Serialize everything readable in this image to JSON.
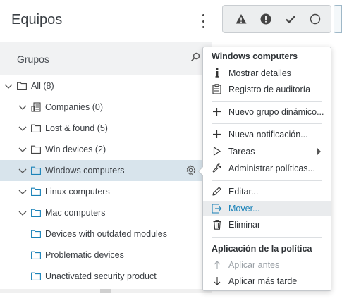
{
  "panel": {
    "title": "Equipos"
  },
  "groups": {
    "label": "Grupos"
  },
  "tree": [
    {
      "label": "All (8)",
      "level": 0,
      "expanded": true,
      "icon": "folder-icon"
    },
    {
      "label": "Companies (0)",
      "level": 1,
      "expanded": true,
      "icon": "companies-icon"
    },
    {
      "label": "Lost & found (5)",
      "level": 1,
      "expanded": true,
      "icon": "folder-icon"
    },
    {
      "label": "Win devices (2)",
      "level": 1,
      "expanded": true,
      "icon": "folder-icon"
    },
    {
      "label": "Windows computers",
      "level": 1,
      "expanded": true,
      "icon": "dynamic-folder-icon",
      "selected": true
    },
    {
      "label": "Linux computers",
      "level": 1,
      "expanded": true,
      "icon": "dynamic-folder-icon"
    },
    {
      "label": "Mac computers",
      "level": 1,
      "expanded": true,
      "icon": "dynamic-folder-icon"
    },
    {
      "label": "Devices with outdated modules",
      "level": 2,
      "icon": "dynamic-folder-icon"
    },
    {
      "label": "Problematic devices",
      "level": 2,
      "icon": "dynamic-folder-icon"
    },
    {
      "label": "Unactivated security product",
      "level": 2,
      "icon": "dynamic-folder-icon"
    }
  ],
  "context_menu": {
    "section1": "Windows computers",
    "items1": [
      {
        "label": "Mostrar detalles",
        "icon": "info-icon"
      },
      {
        "label": "Registro de auditoría",
        "icon": "audit-log-icon"
      }
    ],
    "items2": [
      {
        "label": "Nuevo grupo dinámico...",
        "icon": "plus-icon"
      }
    ],
    "items3": [
      {
        "label": "Nueva notificación...",
        "icon": "plus-icon"
      },
      {
        "label": "Tareas",
        "icon": "play-icon",
        "submenu": true
      },
      {
        "label": "Administrar políticas...",
        "icon": "wrench-icon"
      }
    ],
    "items4": [
      {
        "label": "Editar...",
        "icon": "pencil-icon"
      },
      {
        "label": "Mover...",
        "icon": "move-icon",
        "hover": true
      },
      {
        "label": "Eliminar",
        "icon": "trash-icon"
      }
    ],
    "section2": "Aplicación de la política",
    "items5": [
      {
        "label": "Aplicar antes",
        "icon": "arrow-up-icon",
        "disabled": true
      },
      {
        "label": "Aplicar más tarde",
        "icon": "arrow-down-icon"
      }
    ]
  },
  "colors": {
    "accent": "#1a82b8",
    "selected_row": "#d8e4ec",
    "warning_red": "#e74c3c",
    "warning_orange": "#f0a030"
  }
}
